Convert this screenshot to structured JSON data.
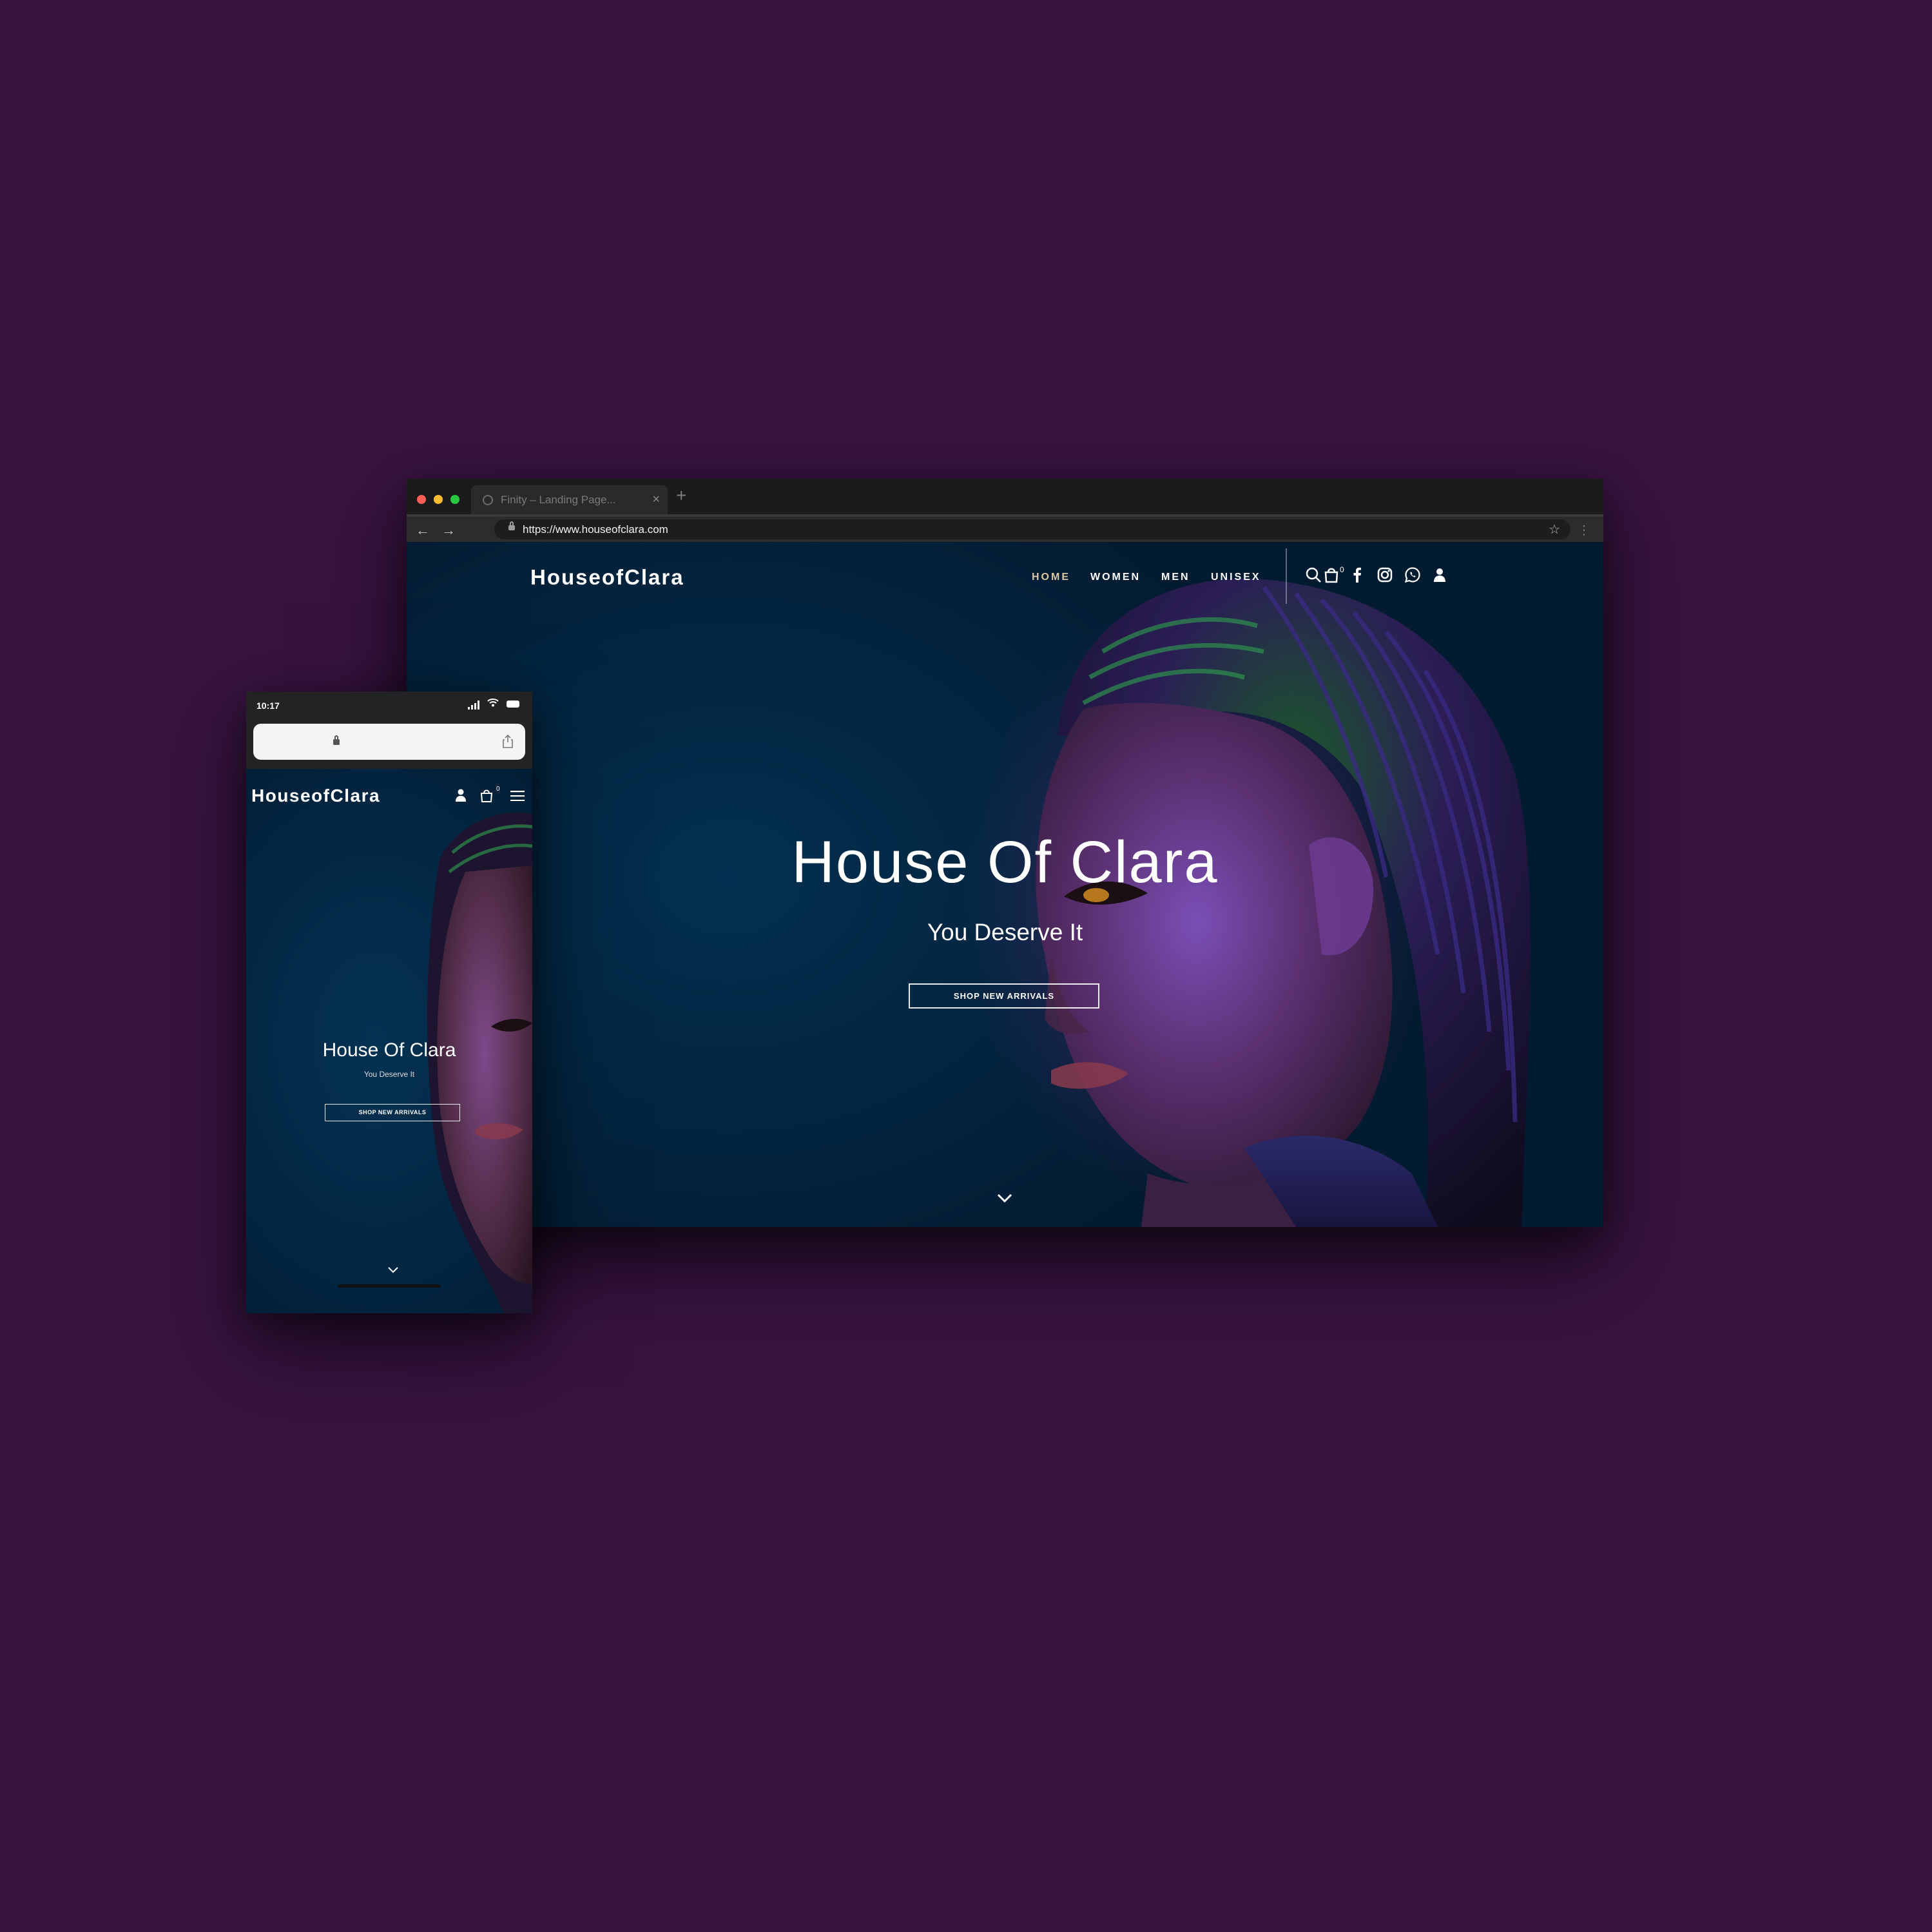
{
  "desktop": {
    "tab": {
      "title": "Finity – Landing Page...",
      "close": "×",
      "new_tab": "+"
    },
    "toolbar": {
      "url": "https://www.houseofclara.com",
      "back": "←",
      "forward": "→",
      "star": "☆",
      "more": "⋮"
    },
    "site": {
      "brand": "HouseofClara",
      "nav": [
        "HOME",
        "WOMEN",
        "MEN",
        "UNISEX"
      ],
      "active_nav": "HOME",
      "cart_count": "0",
      "icons": [
        "search-icon",
        "cart-icon",
        "facebook-icon",
        "instagram-icon",
        "whatsapp-icon",
        "user-icon"
      ],
      "hero": {
        "title": "House Of Clara",
        "subtitle": "You Deserve It",
        "cta": "SHOP NEW ARRIVALS"
      }
    }
  },
  "mobile": {
    "status": {
      "time": "10:17"
    },
    "site": {
      "brand": "HouseofClara",
      "cart_count": "0",
      "hero": {
        "title": "House Of Clara",
        "subtitle": "You Deserve It",
        "cta": "SHOP NEW ARRIVALS"
      }
    }
  },
  "colors": {
    "background": "#381441",
    "hero_blue": "#032540",
    "nav_active": "#d9c7a5"
  }
}
